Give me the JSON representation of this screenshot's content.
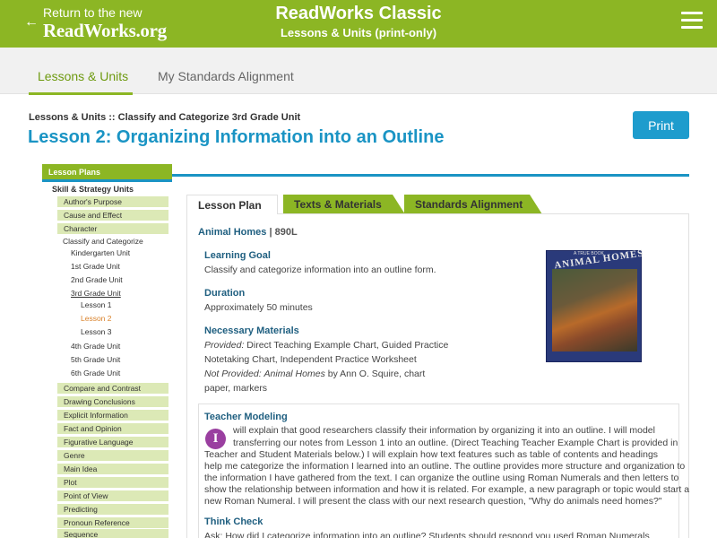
{
  "header": {
    "back_line1": "Return to the new",
    "back_line2": "ReadWorks.org",
    "back_arrow": "←",
    "title": "ReadWorks Classic",
    "subtitle": "Lessons & Units (print-only)",
    "menu_icon": "hamburger-menu-icon",
    "brand_color": "#8cb624"
  },
  "subnav": {
    "tabs": [
      {
        "label": "Lessons & Units",
        "active": true
      },
      {
        "label": "My Standards Alignment",
        "active": false
      }
    ]
  },
  "page": {
    "breadcrumb": "Lessons & Units :: Classify and Categorize 3rd Grade Unit",
    "title": "Lesson 2: Organizing Information into an Outline",
    "print_label": "Print",
    "accent_color": "#1a94c4"
  },
  "sidebar": {
    "header": "Lesson Plans",
    "subheader": "Skill & Strategy Units",
    "items_top": [
      "Author's Purpose",
      "Cause and Effect",
      "Character"
    ],
    "classify": "Classify and Categorize",
    "grades_top": [
      "Kindergarten Unit",
      "1st Grade Unit",
      "2nd Grade Unit",
      "3rd Grade Unit"
    ],
    "lessons": [
      "Lesson 1",
      "Lesson 2",
      "Lesson 3"
    ],
    "grades_bottom": [
      "4th Grade Unit",
      "5th Grade Unit",
      "6th Grade Unit"
    ],
    "items_bottom": [
      "Compare and Contrast",
      "Drawing Conclusions",
      "Explicit Information",
      "Fact and Opinion",
      "Figurative Language",
      "Genre",
      "Main Idea",
      "Plot",
      "Point of View",
      "Predicting",
      "Pronoun Reference",
      "Sequence"
    ]
  },
  "content": {
    "tabs": [
      "Lesson Plan",
      "Texts & Materials",
      "Standards Alignment"
    ],
    "text_title": "Animal Homes",
    "lexile": "| 890L",
    "learning_goal_h": "Learning Goal",
    "learning_goal": "Classify and categorize information into an outline form.",
    "duration_h": "Duration",
    "duration": "Approximately 50 minutes",
    "materials_h": "Necessary Materials",
    "provided_label": "Provided:",
    "provided_1": "Direct Teaching Example Chart, Guided Practice",
    "provided_2": "Notetaking Chart, Independent Practice Worksheet",
    "not_provided_label": "Not Provided:",
    "not_provided_book": "Animal Homes",
    "not_provided_rest": "by Ann O. Squire, chart",
    "not_provided_2": "paper, markers",
    "book_cover_title": "ANIMAL HOMES",
    "book_series": "A TRUE BOOK",
    "teacher_modeling_h": "Teacher Modeling",
    "teacher_icon": "I",
    "teacher_lines": [
      "will explain that good researchers classify their information by organizing it into an outline. I will model",
      "transferring our notes from Lesson 1 into an outline. (Direct Teaching Teacher Example Chart is provided in",
      "Teacher and Student Materials below.) I will explain how text features such as table of contents and headings",
      "help me categorize the information I learned into an outline. The outline provides more structure and organization to",
      "the information I have gathered from the text. I can organize the outline using Roman Numerals and then letters to",
      "show the relationship between information and how it is related. For example, a new paragraph or topic would start a",
      "new Roman Numeral. I will present the class with our next research question, \"Why do animals need homes?\""
    ],
    "think_check_h": "Think Check",
    "think_check": "Ask: How did I categorize information into an outline? Students should respond you used Roman Numerals"
  }
}
